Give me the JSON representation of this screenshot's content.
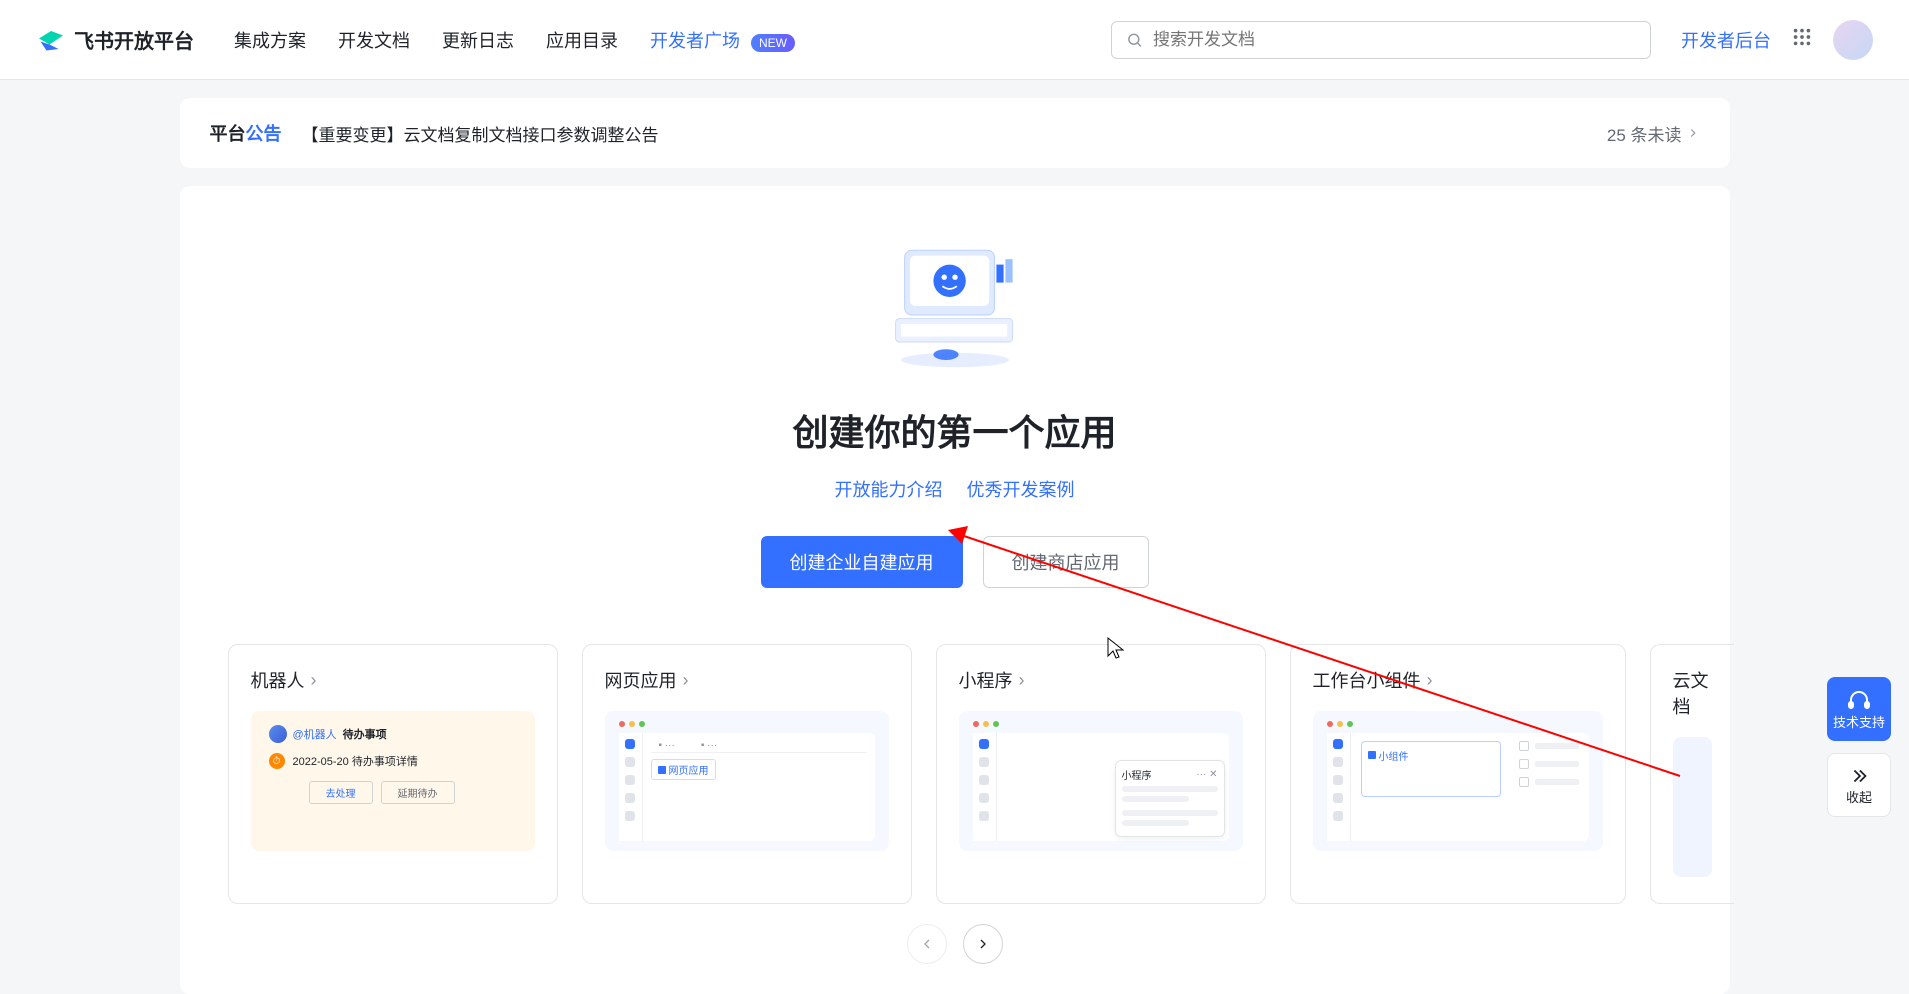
{
  "brand": "飞书开放平台",
  "nav": {
    "integration": "集成方案",
    "docs": "开发文档",
    "changelog": "更新日志",
    "directory": "应用目录",
    "devsquare": "开发者广场",
    "new_badge": "NEW"
  },
  "search": {
    "placeholder": "搜索开发文档"
  },
  "dev_backend": "开发者后台",
  "announce": {
    "title_black": "平台",
    "title_blue": "公告",
    "msg": "【重要变更】云文档复制文档接口参数调整公告",
    "unread": "25 条未读"
  },
  "hero": {
    "title": "创建你的第一个应用",
    "link1": "开放能力介绍",
    "link2": "优秀开发案例",
    "btn_primary": "创建企业自建应用",
    "btn_outline": "创建商店应用"
  },
  "cards": {
    "robot": "机器人",
    "web": "网页应用",
    "mini": "小程序",
    "widget": "工作台小组件",
    "cloud": "云文档",
    "robot_name": "@机器人",
    "robot_todo": "待办事项",
    "robot_line": "2022-05-20 待办事项详情",
    "robot_btn1": "去处理",
    "robot_btn2": "延期待办",
    "web_label": "网页应用",
    "mini_label": "小程序",
    "widget_label": "小组件"
  },
  "float": {
    "support": "技术支持",
    "collapse": "收起"
  }
}
